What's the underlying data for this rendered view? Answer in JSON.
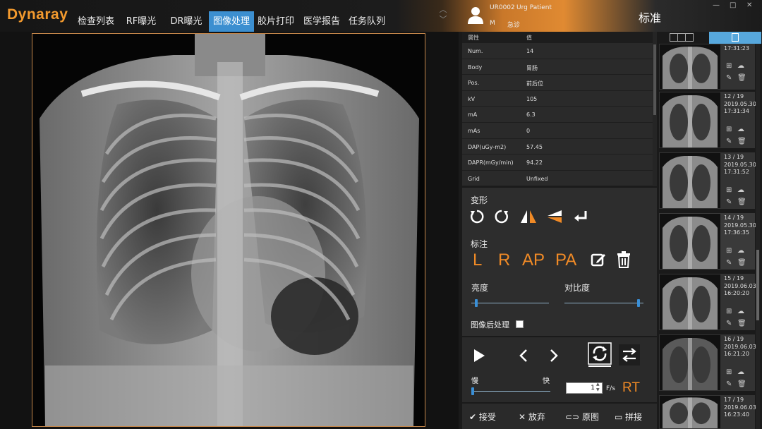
{
  "app": {
    "logo": "Dynaray"
  },
  "tabs": [
    {
      "label": "检查列表"
    },
    {
      "label": "RF曝光"
    },
    {
      "label": "DR曝光"
    },
    {
      "label": "图像处理"
    },
    {
      "label": "胶片打印"
    },
    {
      "label": "医学报告"
    },
    {
      "label": "任务队列"
    }
  ],
  "patient": {
    "id": "UR0002",
    "name": "Urg Patient",
    "sex": "M",
    "type": "急诊"
  },
  "mode_label": "标准",
  "properties": {
    "header_name": "属性",
    "header_value": "值",
    "rows": [
      {
        "name": "Num.",
        "value": "14"
      },
      {
        "name": "Body",
        "value": "胃肠"
      },
      {
        "name": "Pos.",
        "value": "前后位"
      },
      {
        "name": "kV",
        "value": "105"
      },
      {
        "name": "mA",
        "value": "6.3"
      },
      {
        "name": "mAs",
        "value": "0"
      },
      {
        "name": "DAP(uGy-m2)",
        "value": "57.45"
      },
      {
        "name": "DAPR(mGy/min)",
        "value": "94.22"
      },
      {
        "name": "Grid",
        "value": "Unfixed"
      }
    ]
  },
  "tools": {
    "transform_label": "变形",
    "annotation_label": "标注",
    "annotations": [
      "L",
      "R",
      "AP",
      "PA"
    ],
    "brightness_label": "亮度",
    "contrast_label": "对比度",
    "brightness_level": 0.05,
    "contrast_level": 0.95,
    "postprocess_label": "图像后处理"
  },
  "playback": {
    "slow_label": "慢",
    "fast_label": "快",
    "fps_value": "1",
    "fps_unit": "F/s",
    "rt_label": "RT",
    "speed_level": 0.0
  },
  "actions": {
    "accept": "接受",
    "discard": "放弃",
    "original": "原图",
    "stitch": "拼接"
  },
  "accent_colors": {
    "orange": "#f08a26",
    "blue": "#3c8fd0"
  },
  "thumbnails": [
    {
      "index": "",
      "date": "",
      "time": "17:31:23"
    },
    {
      "index": "12 / 19",
      "date": "2019.05.30",
      "time": "17:31:34"
    },
    {
      "index": "13 / 19",
      "date": "2019.05.30",
      "time": "17:31:52"
    },
    {
      "index": "14 / 19",
      "date": "2019.05.30",
      "time": "17:36:35"
    },
    {
      "index": "15 / 19",
      "date": "2019.06.03",
      "time": "16:20:20"
    },
    {
      "index": "16 / 19",
      "date": "2019.06.03",
      "time": "16:21:20"
    },
    {
      "index": "17 / 19",
      "date": "2019.06.03",
      "time": "16:23:40"
    }
  ]
}
